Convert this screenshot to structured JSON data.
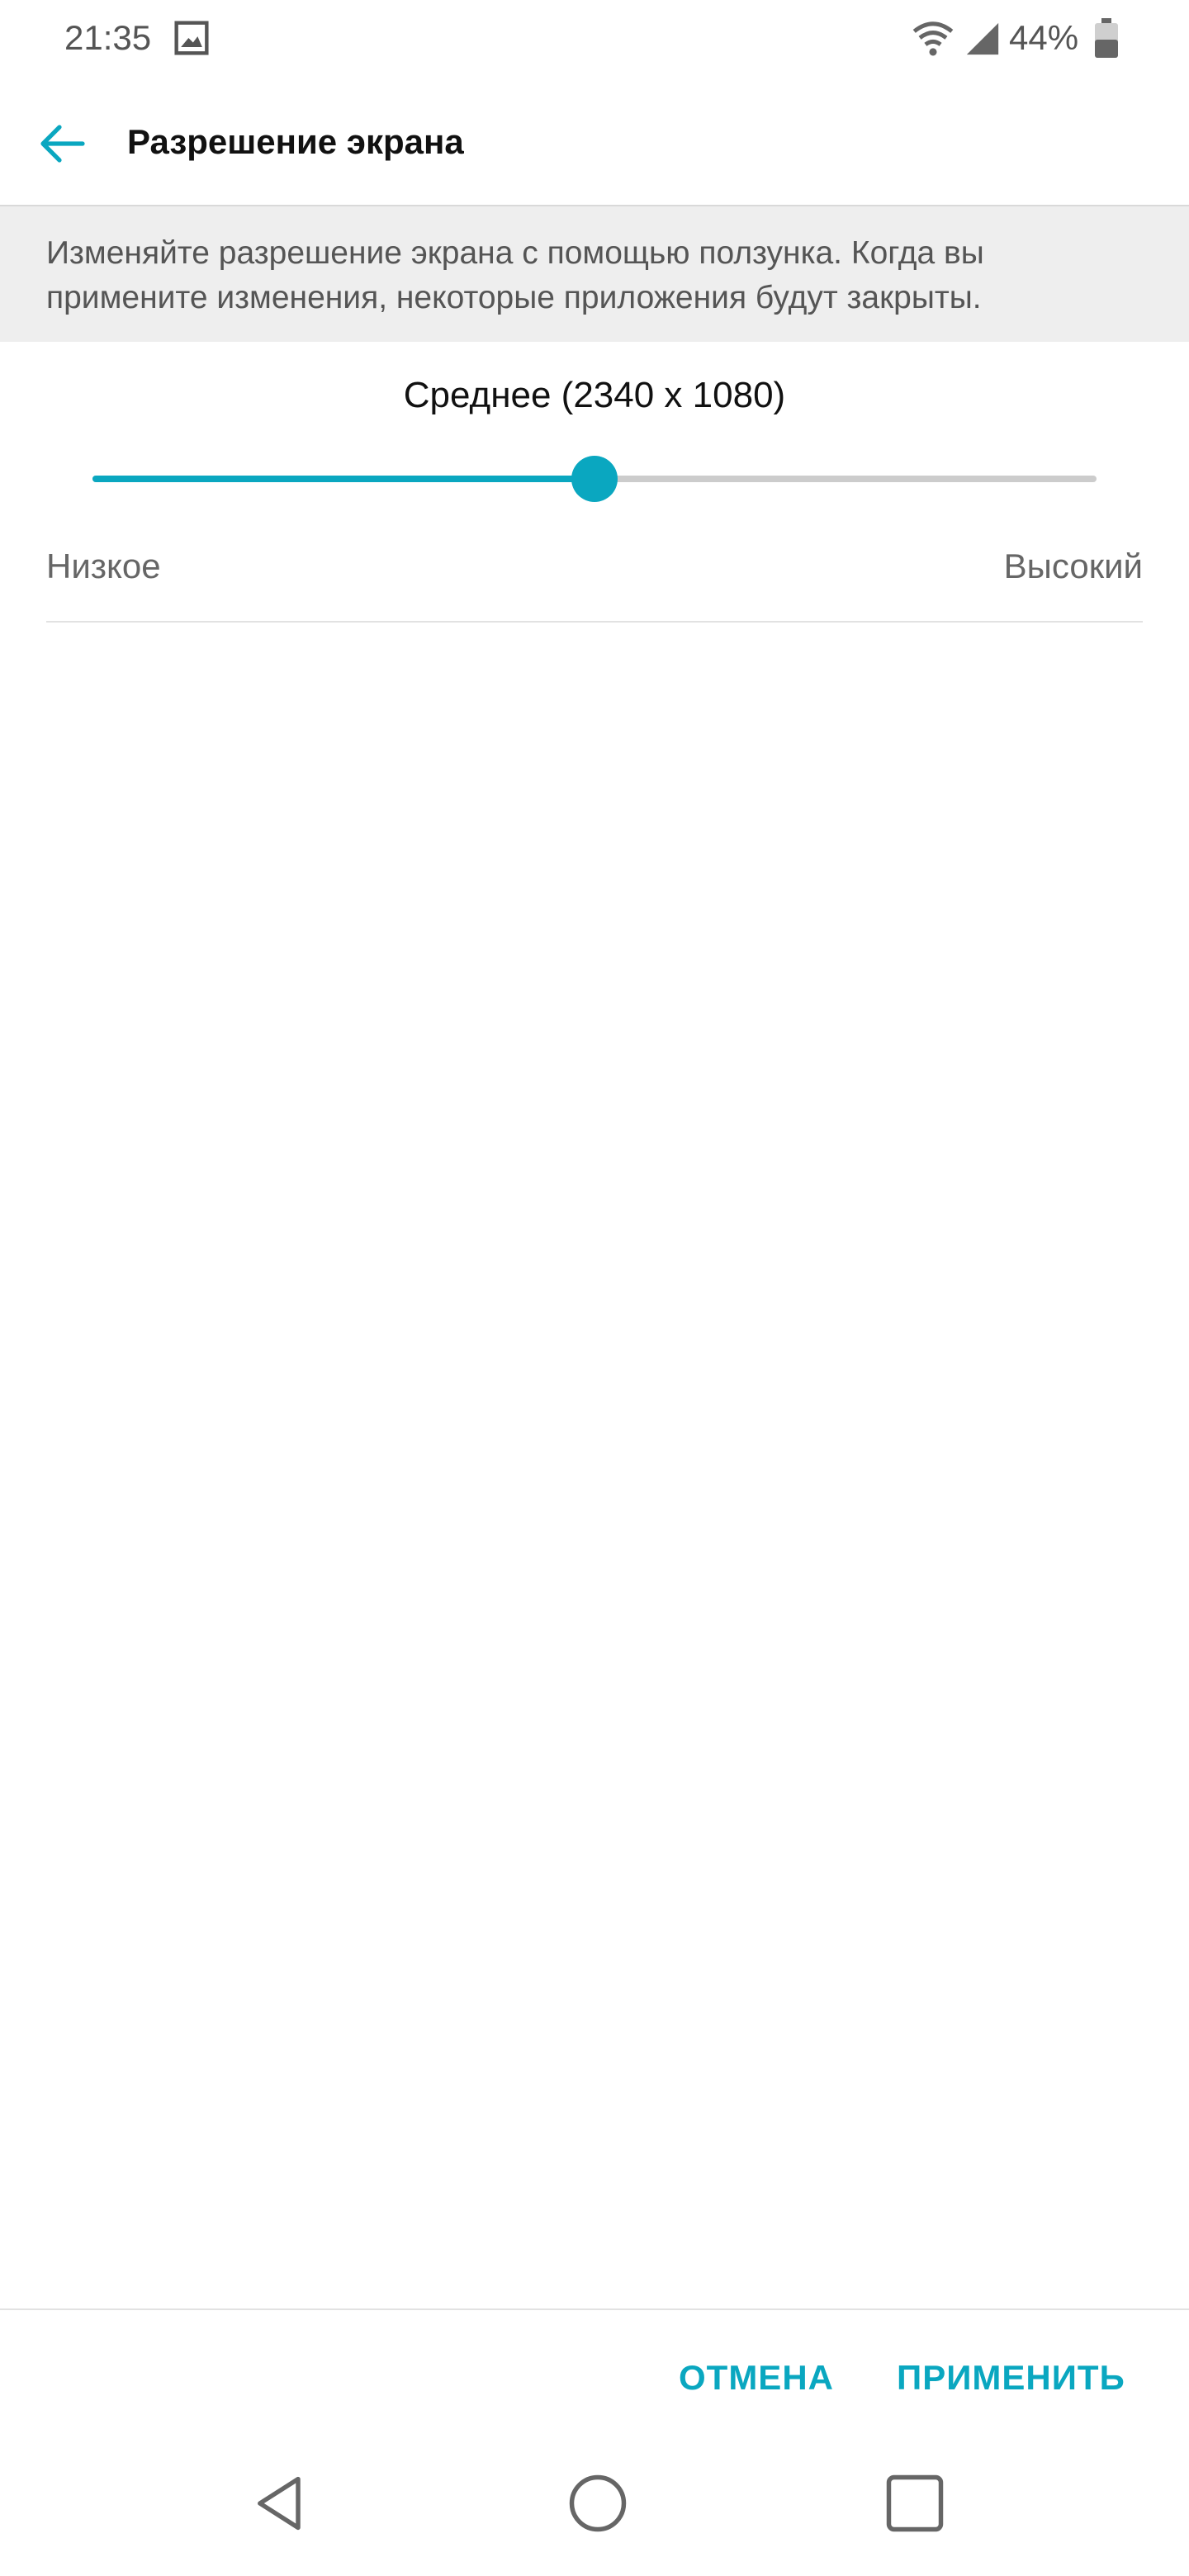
{
  "status_bar": {
    "time": "21:35",
    "battery": "44%",
    "icons": [
      "image-icon",
      "wifi-icon",
      "signal-icon",
      "battery-icon"
    ]
  },
  "header": {
    "title": "Разрешение экрана",
    "back_icon": "back-arrow-icon"
  },
  "description": "Изменяйте разрешение экрана с помощью ползунка. Когда вы примените изменения, некоторые приложения будут закрыты.",
  "resolution": {
    "current_label": "Среднее (2340 x 1080)",
    "slider_level": 0.5,
    "min_label": "Низкое",
    "max_label": "Высокий"
  },
  "actions": {
    "cancel_label": "ОТМЕНА",
    "apply_label": "ПРИМЕНИТЬ"
  },
  "nav_bar": {
    "icons": [
      "nav-back-icon",
      "nav-home-icon",
      "nav-recents-icon"
    ]
  },
  "colors": {
    "accent": "#0aa7c0",
    "track": "#cccccc",
    "info_background": "#eeeeee"
  }
}
